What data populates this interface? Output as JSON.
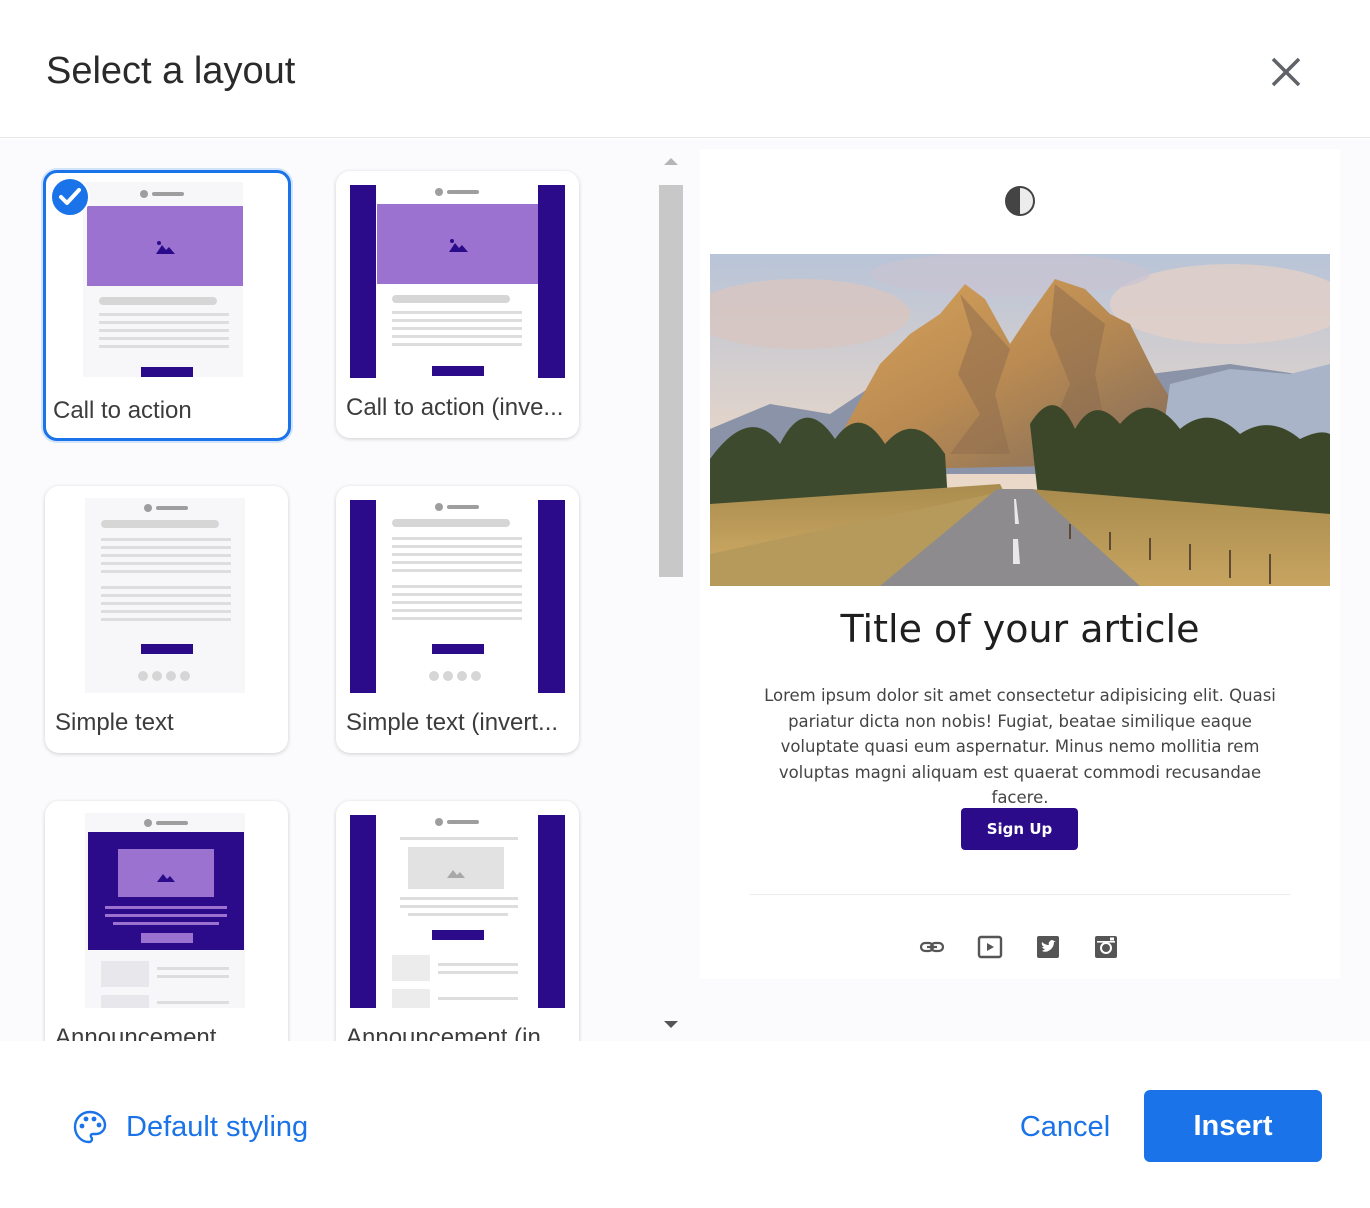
{
  "dialog": {
    "title": "Select a layout"
  },
  "layouts": [
    {
      "label": "Call to action",
      "selected": true
    },
    {
      "label": "Call to action (inve...",
      "selected": false
    },
    {
      "label": "Simple text",
      "selected": false
    },
    {
      "label": "Simple text (invert...",
      "selected": false
    },
    {
      "label": "Announcement",
      "selected": false
    },
    {
      "label": "Announcement (in",
      "selected": false
    }
  ],
  "preview": {
    "article_title": "Title of your article",
    "article_text": "Lorem ipsum dolor sit amet consectetur adipisicing elit. Quasi pariatur dicta non nobis! Fugiat, beatae similique eaque voluptate quasi eum aspernatur. Minus nemo mollitia rem voluptas magni aliquam est quaerat commodi recusandae facere.",
    "button_label": "Sign Up",
    "social_icons": [
      "link-icon",
      "youtube-icon",
      "twitter-icon",
      "instagram-icon"
    ]
  },
  "footer": {
    "styling_label": "Default styling",
    "cancel_label": "Cancel",
    "insert_label": "Insert"
  },
  "colors": {
    "accent": "#1a73e8",
    "template_purple": "#2b0b8a",
    "template_lavender": "#9b72cf"
  }
}
